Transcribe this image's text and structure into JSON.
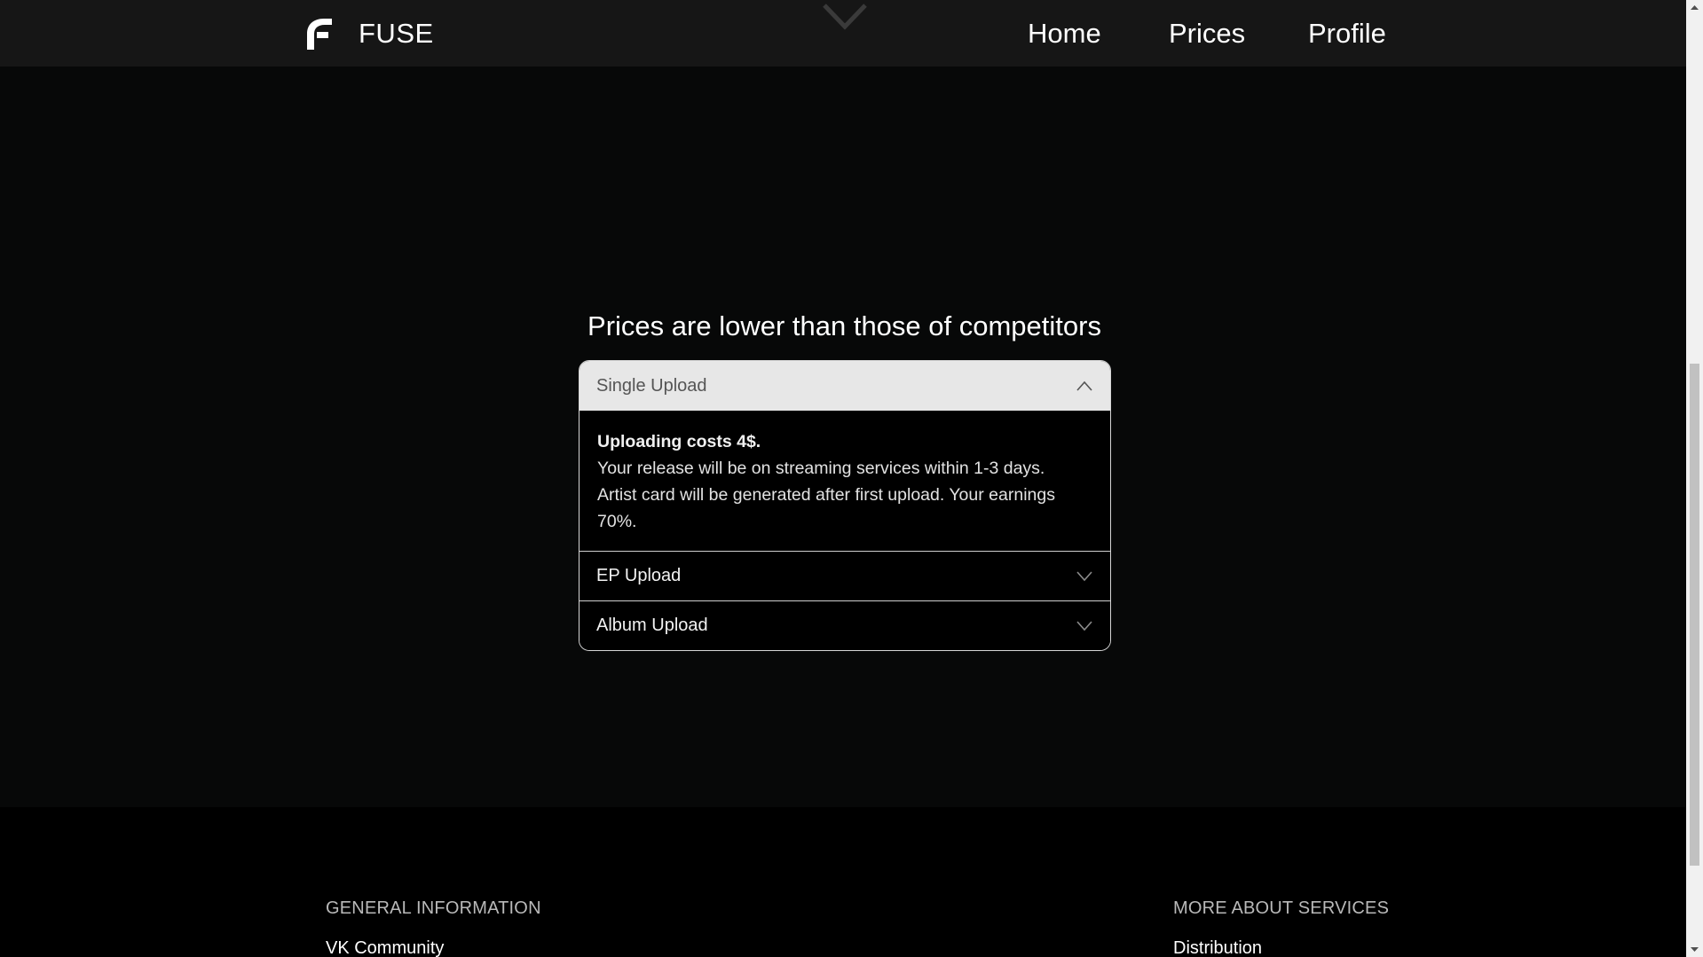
{
  "header": {
    "brand_name": "FUSE",
    "nav": {
      "home": "Home",
      "prices": "Prices",
      "profile": "Profile"
    }
  },
  "main": {
    "title": "Prices are lower than those of competitors",
    "accordion": [
      {
        "label": "Single Upload",
        "expanded": true,
        "body": {
          "headline": "Uploading costs 4$.",
          "line1": "Your release will be on streaming services within 1-3 days.",
          "line2": "Artist card will be generated after first upload. Your earnings 70%."
        }
      },
      {
        "label": "EP Upload",
        "expanded": false
      },
      {
        "label": "Album Upload",
        "expanded": false
      }
    ]
  },
  "footer": {
    "general": {
      "title": "GENERAL INFORMATION",
      "link": "VK Community"
    },
    "services": {
      "title": "MORE ABOUT SERVICES",
      "link": "Distribution"
    }
  },
  "icons": {
    "logo": "fuse-logo-icon",
    "scroll_hint": "chevron-down-icon",
    "expanded": "chevron-up-icon",
    "collapsed": "chevron-down-icon"
  },
  "colors": {
    "background": "#070808",
    "header_bg": "#161616",
    "footer_bg": "#000000",
    "open_header_bg": "#e7e7e7",
    "accordion_border": "#d6d6d6"
  }
}
